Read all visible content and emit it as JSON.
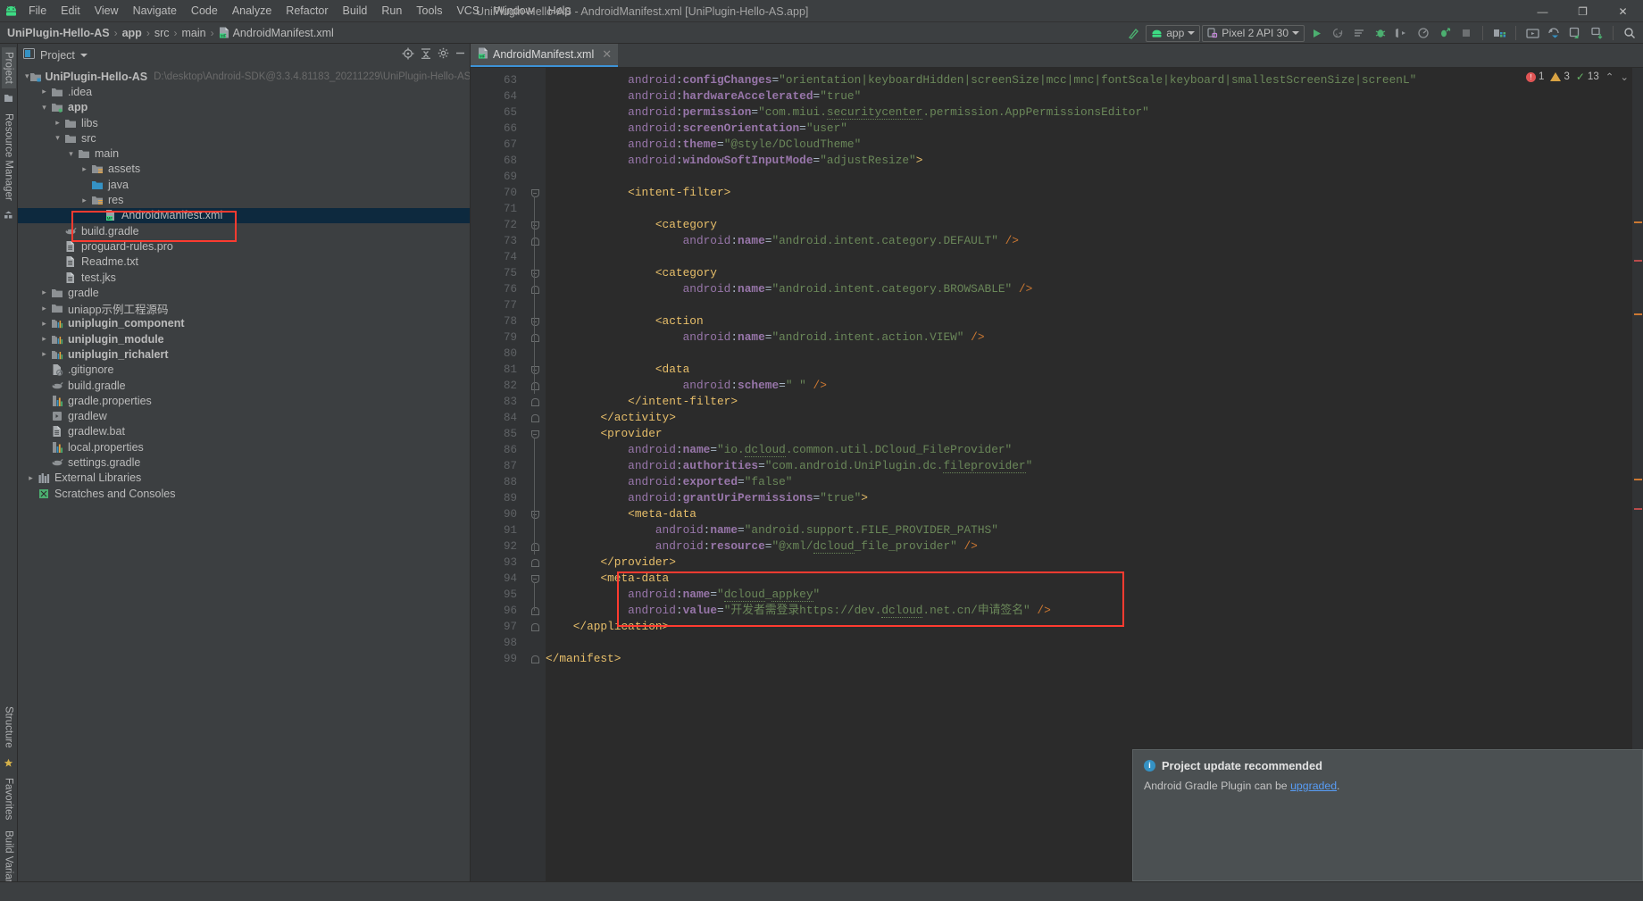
{
  "window": {
    "title": "UniPlugin-Hello-AS - AndroidManifest.xml [UniPlugin-Hello-AS.app]",
    "minimize": "—",
    "maximize": "❐",
    "close": "✕"
  },
  "menubar": {
    "items": [
      "File",
      "Edit",
      "View",
      "Navigate",
      "Code",
      "Analyze",
      "Refactor",
      "Build",
      "Run",
      "Tools",
      "VCS",
      "Window",
      "Help"
    ]
  },
  "breadcrumb": {
    "items": [
      "UniPlugin-Hello-AS",
      "app",
      "src",
      "main",
      "AndroidManifest.xml"
    ],
    "separator": "›"
  },
  "toolbar": {
    "module_selector": "app",
    "device_selector": "Pixel 2 API 30",
    "icons": [
      "magic-wand-icon",
      "run-icon",
      "rerun-icon",
      "run-with-coverage-icon",
      "debug-icon",
      "profile-icon",
      "apply-changes-icon",
      "stop-icon",
      "sdk-manager-icon",
      "avd-manager-icon",
      "sync-gradle-icon",
      "layout-inspector-icon",
      "device-file-explorer-icon",
      "search-icon"
    ]
  },
  "left_rail": {
    "top": [
      "Project",
      "Resource Manager"
    ],
    "bottom": [
      "Structure",
      "Favorites",
      "Build Variants"
    ]
  },
  "project_panel": {
    "header": "Project",
    "header_icons": [
      "target-icon",
      "collapse-all-icon",
      "settings-icon",
      "hide-icon"
    ],
    "tree": [
      {
        "label": "UniPlugin-Hello-AS",
        "path": "D:\\desktop\\Android-SDK@3.3.4.81183_20211229\\UniPlugin-Hello-AS",
        "indent": 0,
        "arrow": "down",
        "icon": "module-icon",
        "bold": true
      },
      {
        "label": ".idea",
        "indent": 1,
        "arrow": "right",
        "icon": "folder-icon"
      },
      {
        "label": "app",
        "indent": 1,
        "arrow": "down",
        "icon": "module-app-icon",
        "bold": true
      },
      {
        "label": "libs",
        "indent": 2,
        "arrow": "right",
        "icon": "folder-icon"
      },
      {
        "label": "src",
        "indent": 2,
        "arrow": "down",
        "icon": "folder-icon"
      },
      {
        "label": "main",
        "indent": 3,
        "arrow": "down",
        "icon": "folder-icon"
      },
      {
        "label": "assets",
        "indent": 4,
        "arrow": "right",
        "icon": "assets-folder-icon"
      },
      {
        "label": "java",
        "indent": 4,
        "arrow": "none",
        "icon": "java-source-folder-icon"
      },
      {
        "label": "res",
        "indent": 4,
        "arrow": "right",
        "icon": "res-folder-icon"
      },
      {
        "label": "AndroidManifest.xml",
        "indent": 5,
        "arrow": "none",
        "icon": "manifest-file-icon",
        "selected": true
      },
      {
        "label": "build.gradle",
        "indent": 2,
        "arrow": "none",
        "icon": "gradle-file-icon"
      },
      {
        "label": "proguard-rules.pro",
        "indent": 2,
        "arrow": "none",
        "icon": "text-file-icon"
      },
      {
        "label": "Readme.txt",
        "indent": 2,
        "arrow": "none",
        "icon": "text-file-icon"
      },
      {
        "label": "test.jks",
        "indent": 2,
        "arrow": "none",
        "icon": "text-file-icon"
      },
      {
        "label": "gradle",
        "indent": 1,
        "arrow": "right",
        "icon": "folder-icon"
      },
      {
        "label": "uniapp示例工程源码",
        "indent": 1,
        "arrow": "right",
        "icon": "folder-icon"
      },
      {
        "label": "uniplugin_component",
        "indent": 1,
        "arrow": "right",
        "icon": "module-lib-icon",
        "bold": true
      },
      {
        "label": "uniplugin_module",
        "indent": 1,
        "arrow": "right",
        "icon": "module-lib-icon",
        "bold": true
      },
      {
        "label": "uniplugin_richalert",
        "indent": 1,
        "arrow": "right",
        "icon": "module-lib-icon",
        "bold": true
      },
      {
        "label": ".gitignore",
        "indent": 1,
        "arrow": "none",
        "icon": "gitignore-file-icon"
      },
      {
        "label": "build.gradle",
        "indent": 1,
        "arrow": "none",
        "icon": "gradle-file-icon"
      },
      {
        "label": "gradle.properties",
        "indent": 1,
        "arrow": "none",
        "icon": "properties-file-icon"
      },
      {
        "label": "gradlew",
        "indent": 1,
        "arrow": "none",
        "icon": "script-file-icon"
      },
      {
        "label": "gradlew.bat",
        "indent": 1,
        "arrow": "none",
        "icon": "text-file-icon"
      },
      {
        "label": "local.properties",
        "indent": 1,
        "arrow": "none",
        "icon": "properties-file-icon"
      },
      {
        "label": "settings.gradle",
        "indent": 1,
        "arrow": "none",
        "icon": "gradle-file-icon"
      },
      {
        "label": "External Libraries",
        "indent": 0,
        "arrow": "right",
        "icon": "external-libraries-icon"
      },
      {
        "label": "Scratches and Consoles",
        "indent": 0,
        "arrow": "none",
        "icon": "scratches-icon"
      }
    ]
  },
  "editor": {
    "tab": {
      "label": "AndroidManifest.xml",
      "close": "✕",
      "icon": "manifest-file-icon"
    },
    "inspections": {
      "errors": "1",
      "warnings": "3",
      "ok": "13",
      "collapse": "⌃",
      "expand": "⌄"
    },
    "first_line": 63,
    "lines": [
      {
        "n": 63,
        "fold": "",
        "text": "            android:configChanges=\"orientation|keyboardHidden|screenSize|mcc|mnc|fontScale|keyboard|smallestScreenSize|screenL"
      },
      {
        "n": 64,
        "fold": "",
        "text": "            android:hardwareAccelerated=\"true\""
      },
      {
        "n": 65,
        "fold": "",
        "text": "            android:permission=\"com.miui.securitycenter.permission.AppPermissionsEditor\""
      },
      {
        "n": 66,
        "fold": "",
        "text": "            android:screenOrientation=\"user\""
      },
      {
        "n": 67,
        "fold": "",
        "text": "            android:theme=\"@style/DCloudTheme\""
      },
      {
        "n": 68,
        "fold": "",
        "text": "            android:windowSoftInputMode=\"adjustResize\">"
      },
      {
        "n": 69,
        "fold": "",
        "text": ""
      },
      {
        "n": 70,
        "fold": "minus",
        "text": "            <intent-filter>"
      },
      {
        "n": 71,
        "fold": "",
        "text": ""
      },
      {
        "n": 72,
        "fold": "minus",
        "text": "                <category"
      },
      {
        "n": 73,
        "fold": "end",
        "text": "                    android:name=\"android.intent.category.DEFAULT\" />"
      },
      {
        "n": 74,
        "fold": "",
        "text": ""
      },
      {
        "n": 75,
        "fold": "minus",
        "text": "                <category"
      },
      {
        "n": 76,
        "fold": "end",
        "text": "                    android:name=\"android.intent.category.BROWSABLE\" />"
      },
      {
        "n": 77,
        "fold": "",
        "text": ""
      },
      {
        "n": 78,
        "fold": "minus",
        "text": "                <action"
      },
      {
        "n": 79,
        "fold": "end",
        "text": "                    android:name=\"android.intent.action.VIEW\" />"
      },
      {
        "n": 80,
        "fold": "",
        "text": ""
      },
      {
        "n": 81,
        "fold": "minus",
        "text": "                <data"
      },
      {
        "n": 82,
        "fold": "end",
        "text": "                    android:scheme=\" \" />"
      },
      {
        "n": 83,
        "fold": "end",
        "text": "            </intent-filter>"
      },
      {
        "n": 84,
        "fold": "end",
        "text": "        </activity>"
      },
      {
        "n": 85,
        "fold": "minus",
        "text": "        <provider"
      },
      {
        "n": 86,
        "fold": "",
        "text": "            android:name=\"io.dcloud.common.util.DCloud_FileProvider\""
      },
      {
        "n": 87,
        "fold": "",
        "text": "            android:authorities=\"com.android.UniPlugin.dc.fileprovider\""
      },
      {
        "n": 88,
        "fold": "",
        "text": "            android:exported=\"false\""
      },
      {
        "n": 89,
        "fold": "",
        "text": "            android:grantUriPermissions=\"true\">"
      },
      {
        "n": 90,
        "fold": "minus",
        "text": "            <meta-data"
      },
      {
        "n": 91,
        "fold": "",
        "text": "                android:name=\"android.support.FILE_PROVIDER_PATHS\""
      },
      {
        "n": 92,
        "fold": "end",
        "text": "                android:resource=\"@xml/dcloud_file_provider\" />"
      },
      {
        "n": 93,
        "fold": "end",
        "text": "        </provider>"
      },
      {
        "n": 94,
        "fold": "minus",
        "text": "        <meta-data"
      },
      {
        "n": 95,
        "fold": "",
        "text": "            android:name=\"dcloud_appkey\""
      },
      {
        "n": 96,
        "fold": "end",
        "text": "            android:value=\"开发者需登录https://dev.dcloud.net.cn/申请签名\" />"
      },
      {
        "n": 97,
        "fold": "end",
        "text": "    </application>"
      },
      {
        "n": 98,
        "fold": "",
        "text": ""
      },
      {
        "n": 99,
        "fold": "end",
        "text": "</manifest>"
      }
    ]
  },
  "notification": {
    "title": "Project update recommended",
    "icon": "info-icon",
    "body_before_link": "Android Gradle Plugin can be ",
    "body_link": "upgraded",
    "body_after_link": "."
  },
  "colors": {
    "accent_blue": "#3d93d7",
    "annotation_red": "#ff3b30",
    "selection_blue": "#0d293e",
    "editor_bg": "#2b2b2b",
    "panel_bg": "#3c3f41",
    "string_green": "#6a8759",
    "attr_purple": "#9876aa",
    "tag_yellow": "#e8bf6a"
  }
}
